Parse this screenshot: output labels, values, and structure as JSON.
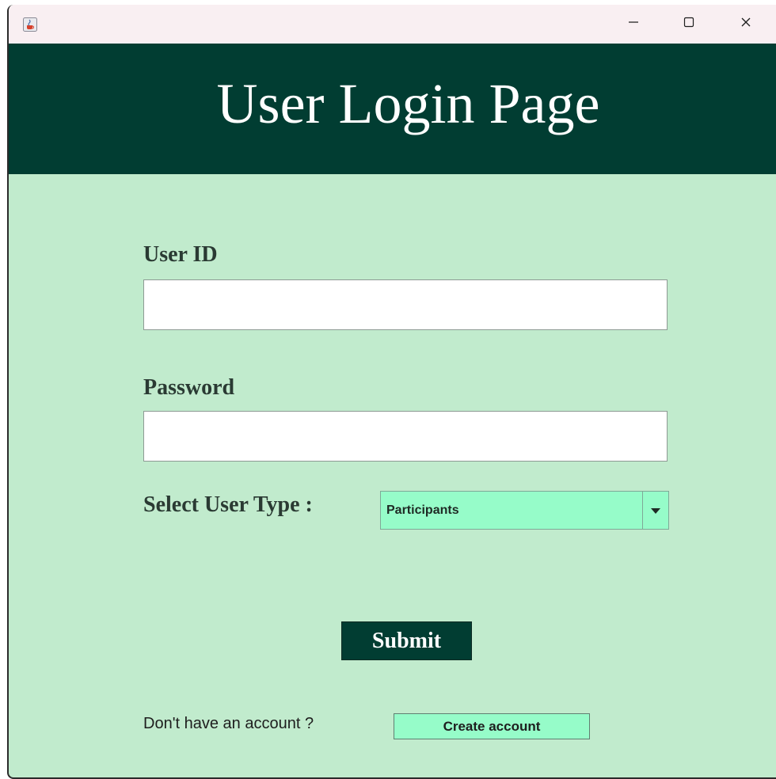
{
  "window": {
    "app_icon": "java-coffee-icon",
    "controls": {
      "minimize_icon": "minimize-icon",
      "maximize_icon": "maximize-icon",
      "close_icon": "close-icon"
    }
  },
  "header": {
    "title": "User Login Page",
    "background_color": "#013d32"
  },
  "form": {
    "user_id": {
      "label": "User ID",
      "value": "",
      "placeholder": ""
    },
    "password": {
      "label": "Password",
      "value": "",
      "placeholder": ""
    },
    "user_type": {
      "label": "Select User Type :",
      "selected": "Participants",
      "arrow_icon": "chevron-down-icon"
    },
    "submit_label": "Submit"
  },
  "footer": {
    "prompt": "Don't have an account ?",
    "create_label": "Create account"
  },
  "colors": {
    "body_background": "#c1ebcd",
    "accent_light": "#96fcc9",
    "titlebar": "#f9eff2"
  }
}
